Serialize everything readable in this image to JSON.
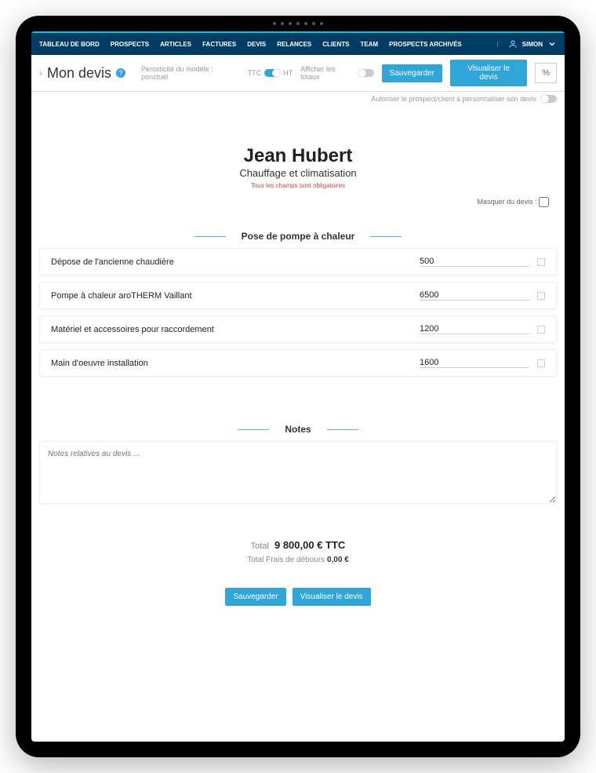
{
  "nav": {
    "items": [
      "TABLEAU DE BORD",
      "PROSPECTS",
      "ARTICLES",
      "FACTURES",
      "DEVIS",
      "RELANCES",
      "CLIENTS",
      "TEAM",
      "PROSPECTS ARCHIVÉS"
    ],
    "user": "SIMON"
  },
  "toolbar": {
    "title": "Mon devis",
    "periodicity_label": "Périodicité du modèle : ponctuel",
    "ttc_label": "TTC",
    "ht_label": "HT",
    "show_totals_label": "Afficher les totaux",
    "save_label": "Sauvegarder",
    "view_label": "Visualiser le devis",
    "percent_label": "%",
    "allow_customize_label": "Autoriser le prospect/client à personnaliser son devis"
  },
  "client": {
    "name": "Jean Hubert",
    "activity": "Chauffage et climatisation",
    "required_note": "Tous les champs sont obligatoires"
  },
  "section": {
    "title": "Pose de pompe à chaleur",
    "hide_label": "Masquer du devis :"
  },
  "items": [
    {
      "desc": "Dépose de l'ancienne chaudière",
      "price": "500"
    },
    {
      "desc": "Pompe à chaleur aroTHERM Vaillant",
      "price": "6500"
    },
    {
      "desc": "Matériel et accessoires pour raccordement",
      "price": "1200"
    },
    {
      "desc": "Main d'oeuvre installation",
      "price": "1600"
    }
  ],
  "notes": {
    "title": "Notes",
    "placeholder": "Notes relatives au devis ..."
  },
  "totals": {
    "total_label": "Total",
    "total_value": "9 800,00 € TTC",
    "fees_label": "Total Frais de débours",
    "fees_value": "0,00 €"
  },
  "footer": {
    "save_label": "Sauvegarder",
    "view_label": "Visualiser le devis"
  }
}
